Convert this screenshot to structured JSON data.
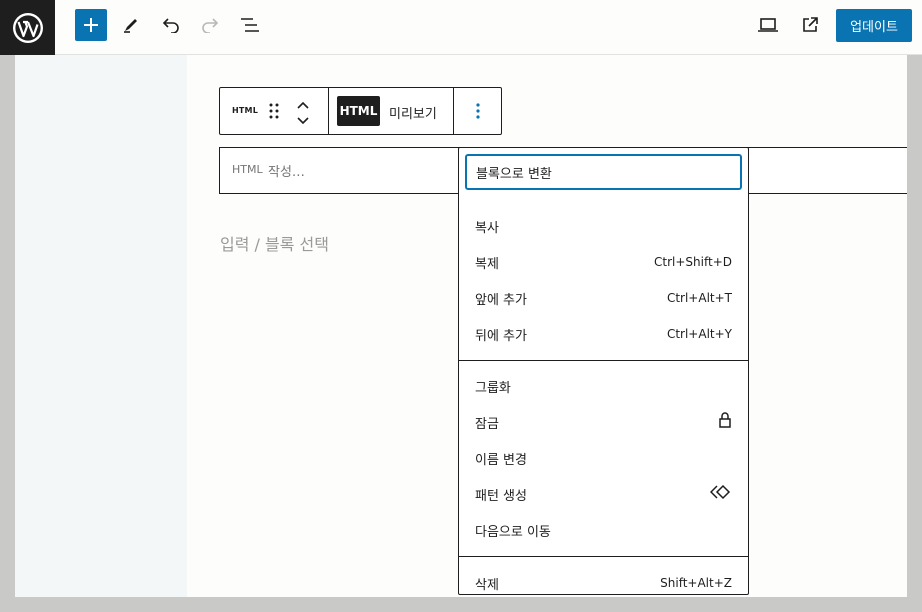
{
  "toolbar": {
    "update_label": "업데이트",
    "accent": "#0a74b2"
  },
  "block_toolbar": {
    "block_type": "HTML",
    "html_toggle": "HTML",
    "preview": "미리보기"
  },
  "html_block": {
    "label": "HTML",
    "placeholder": "작성…"
  },
  "appender": "입력 / 블록 선택",
  "menu": {
    "items": [
      {
        "label": "블록으로 변환",
        "shortcut": ""
      },
      {
        "label": "복사",
        "shortcut": ""
      },
      {
        "label": "복제",
        "shortcut": "Ctrl+Shift+D"
      },
      {
        "label": "앞에 추가",
        "shortcut": "Ctrl+Alt+T"
      },
      {
        "label": "뒤에 추가",
        "shortcut": "Ctrl+Alt+Y"
      },
      {
        "label": "그룹화",
        "shortcut": ""
      },
      {
        "label": "잠금",
        "shortcut": "",
        "icon": "lock-icon"
      },
      {
        "label": "이름 변경",
        "shortcut": ""
      },
      {
        "label": "패턴 생성",
        "shortcut": "",
        "icon": "pattern-icon"
      },
      {
        "label": "다음으로 이동",
        "shortcut": ""
      },
      {
        "label": "삭제",
        "shortcut": "Shift+Alt+Z"
      }
    ]
  }
}
